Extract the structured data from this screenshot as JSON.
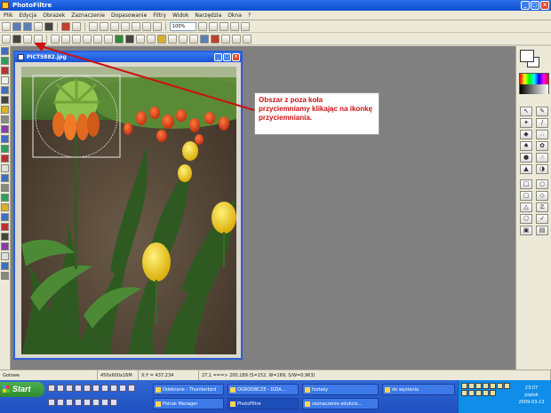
{
  "app": {
    "title": "PhotoFiltre",
    "window_controls": {
      "minimize": "_",
      "maximize": "□",
      "close": "×"
    }
  },
  "menu": [
    "Plik",
    "Edycja",
    "Obrazek",
    "Zaznaczenie",
    "Dopasowanie",
    "Filtry",
    "Widok",
    "Narzędzia",
    "Okna",
    "?"
  ],
  "toolbar": {
    "zoom_value": "100%"
  },
  "document": {
    "title": "PICT5882.jpg"
  },
  "callout": {
    "text": "Obszar z poza koła przyciemniamy klikając na ikonkę przyciemniania."
  },
  "statusbar": {
    "state": "Gotowe",
    "image_size": "450x600x16M",
    "coords": "X:Y = 437:234",
    "selection": "27,1 ===> 200,189 (S=152, W=169, S/W=0,963)"
  },
  "taskbar": {
    "start_label": "Start",
    "buttons_row1": [
      "Odebrane - Thunderbird",
      "OGRODBCZE - DZIA...",
      "foztaky",
      "do wystania"
    ],
    "buttons_row2": [
      "Potrak Manager",
      "PhotoFiltre",
      "zaznaczenie edukcio..."
    ],
    "clock_time": "23:07",
    "clock_day": "piątek",
    "clock_date": "2009-03-13"
  },
  "colors": {
    "callout_text": "#cc1111",
    "arrow": "#cc1111",
    "title_bar": "#0c4fd0"
  }
}
